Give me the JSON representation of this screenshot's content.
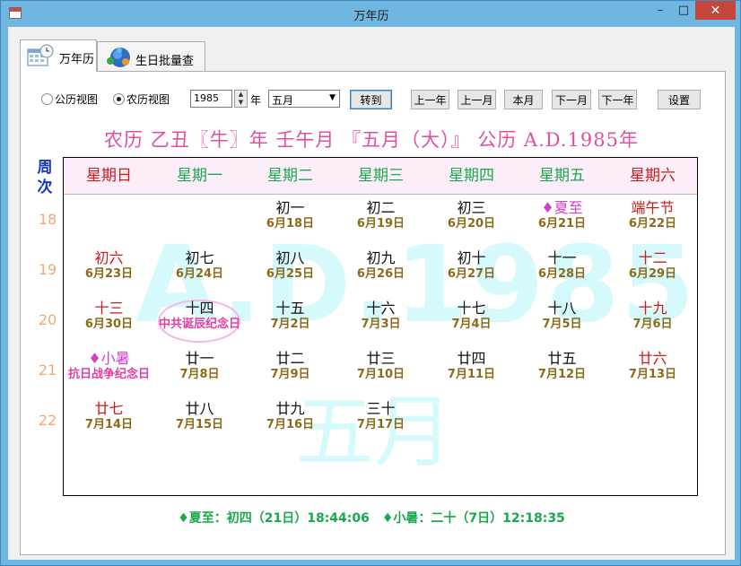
{
  "window": {
    "title": "万年历",
    "minimize": "–",
    "maximize": "□",
    "close": "✕"
  },
  "tabs": [
    {
      "label": "万年历",
      "icon": "calendar-clock-icon"
    },
    {
      "label": "生日批量查询",
      "icon": "globe-people-icon"
    }
  ],
  "toolbar": {
    "radio_solar": "公历视图",
    "radio_lunar": "农历视图",
    "year_value": "1985",
    "year_label": "年",
    "month_value": "五月",
    "go_button": "转到",
    "prev_year": "上一年",
    "prev_month": "上一月",
    "this_month": "本月",
    "next_month": "下一月",
    "next_year": "下一年",
    "settings": "设置"
  },
  "calendar": {
    "heading": "农历 乙丑〖牛〗年 壬午月 『五月（大）』 公历 A.D.1985年",
    "week_label": "周次",
    "watermark_year": "A.D.1985",
    "watermark_month": "五月",
    "weekdays": [
      {
        "name": "星期日",
        "color": "#d01818"
      },
      {
        "name": "星期一",
        "color": "#1aa84e"
      },
      {
        "name": "星期二",
        "color": "#1aa84e"
      },
      {
        "name": "星期三",
        "color": "#1aa84e"
      },
      {
        "name": "星期四",
        "color": "#1aa84e"
      },
      {
        "name": "星期五",
        "color": "#1aa84e"
      },
      {
        "name": "星期六",
        "color": "#d01818"
      }
    ],
    "weeks": [
      {
        "num": "18",
        "days": [
          null,
          null,
          {
            "lunar": "初一",
            "solar": "6月18日",
            "color": "#111111"
          },
          {
            "lunar": "初二",
            "solar": "6月19日",
            "color": "#111111"
          },
          {
            "lunar": "初三",
            "solar": "6月20日",
            "color": "#111111"
          },
          {
            "lunar": "♦夏至",
            "solar": "6月21日",
            "color": "#d040c8"
          },
          {
            "lunar": "端午节",
            "solar": "6月22日",
            "color": "#d01818"
          }
        ]
      },
      {
        "num": "19",
        "days": [
          {
            "lunar": "初六",
            "solar": "6月23日",
            "color": "#d01818"
          },
          {
            "lunar": "初七",
            "solar": "6月24日",
            "color": "#111111"
          },
          {
            "lunar": "初八",
            "solar": "6月25日",
            "color": "#111111"
          },
          {
            "lunar": "初九",
            "solar": "6月26日",
            "color": "#111111"
          },
          {
            "lunar": "初十",
            "solar": "6月27日",
            "color": "#111111"
          },
          {
            "lunar": "十一",
            "solar": "6月28日",
            "color": "#111111"
          },
          {
            "lunar": "十二",
            "solar": "6月29日",
            "color": "#d01818"
          }
        ]
      },
      {
        "num": "20",
        "days": [
          {
            "lunar": "十三",
            "solar": "6月30日",
            "color": "#d01818"
          },
          {
            "lunar": "十四",
            "fest": "中共诞辰纪念日",
            "color": "#111111"
          },
          {
            "lunar": "十五",
            "solar": "7月2日",
            "color": "#111111"
          },
          {
            "lunar": "十六",
            "solar": "7月3日",
            "color": "#111111"
          },
          {
            "lunar": "十七",
            "solar": "7月4日",
            "color": "#111111"
          },
          {
            "lunar": "十八",
            "solar": "7月5日",
            "color": "#111111"
          },
          {
            "lunar": "十九",
            "solar": "7月6日",
            "color": "#d01818"
          }
        ]
      },
      {
        "num": "21",
        "days": [
          {
            "lunar": "♦小暑",
            "fest": "抗日战争纪念日",
            "color": "#d040c8"
          },
          {
            "lunar": "廿一",
            "solar": "7月8日",
            "color": "#111111"
          },
          {
            "lunar": "廿二",
            "solar": "7月9日",
            "color": "#111111"
          },
          {
            "lunar": "廿三",
            "solar": "7月10日",
            "color": "#111111"
          },
          {
            "lunar": "廿四",
            "solar": "7月11日",
            "color": "#111111"
          },
          {
            "lunar": "廿五",
            "solar": "7月12日",
            "color": "#111111"
          },
          {
            "lunar": "廿六",
            "solar": "7月13日",
            "color": "#d01818"
          }
        ]
      },
      {
        "num": "22",
        "days": [
          {
            "lunar": "廿七",
            "solar": "7月14日",
            "color": "#d01818"
          },
          {
            "lunar": "廿八",
            "solar": "7月15日",
            "color": "#111111"
          },
          {
            "lunar": "廿九",
            "solar": "7月16日",
            "color": "#111111"
          },
          {
            "lunar": "三十",
            "solar": "7月17日",
            "color": "#111111"
          },
          null,
          null,
          null
        ]
      }
    ],
    "solar_terms": "♦夏至：初四（21日）18:44:06　♦小暑：二十（7日）12:18:35"
  }
}
